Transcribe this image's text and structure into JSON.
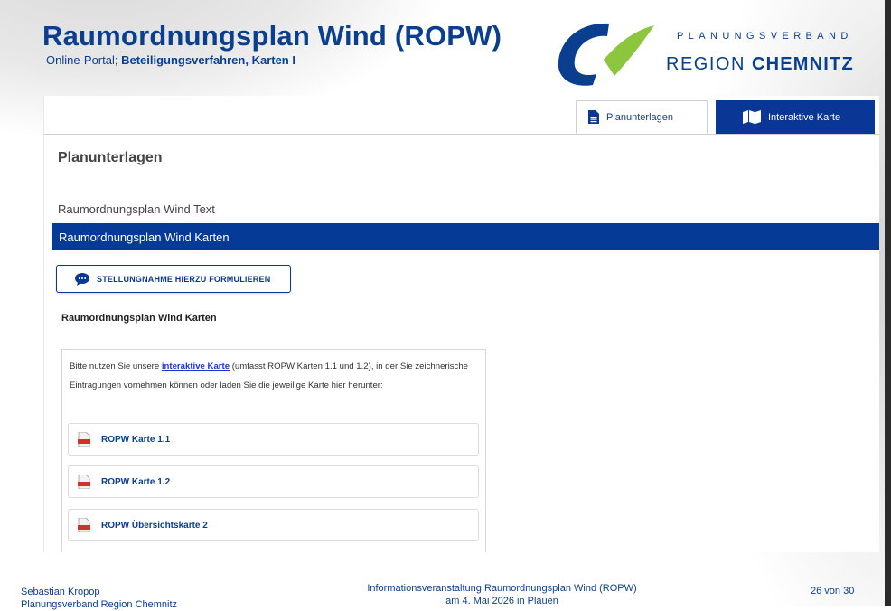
{
  "slide": {
    "title": "Raumordnungsplan Wind (ROPW)",
    "subtitle_prefix": "Online-Portal; ",
    "subtitle_bold": "Beteiligungsverfahren, Karten I"
  },
  "logo": {
    "line1": "PLANUNGSVERBAND",
    "line2_regular": "REGION ",
    "line2_bold": "CHEMNITZ",
    "colors": {
      "blue": "#0a3f8f",
      "green": "#8cc63f"
    }
  },
  "tabs": [
    {
      "label": "Planunterlagen",
      "icon": "document-icon",
      "active": true
    },
    {
      "label": "Interaktive Karte",
      "icon": "map-icon",
      "active": false
    }
  ],
  "page": {
    "section_title": "Planunterlagen",
    "nav_items": [
      "Raumordnungsplan Wind Text",
      "Raumordnungsplan Wind Karten"
    ],
    "statement_button": "STELLUNGNAHME HIERZU FORMULIEREN",
    "content_heading": "Raumordnungsplan Wind Karten",
    "info": {
      "before": "Bitte nutzen Sie unsere ",
      "link": "interaktive Karte",
      "after": " (umfasst ROPW Karten 1.1 und 1.2), in der Sie zeichnerische Eintragungen vornehmen können oder laden Sie die jeweilige Karte hier herunter:"
    },
    "files": [
      "ROPW Karte 1.1",
      "ROPW Karte 1.2",
      "ROPW Übersichtskarte 2"
    ]
  },
  "footer": {
    "author": "Sebastian Kropop",
    "organisation": "Planungsverband Region Chemnitz",
    "event_line1": "Informationsveranstaltung Raumordnungsplan Wind (ROPW)",
    "event_line2": "am 4. Mai 2026 in Plauen",
    "page": "26 von 30"
  },
  "colors": {
    "primary": "#0a3796",
    "title": "#0a3f8f",
    "link": "#1a33d6",
    "pdf": "#d0312d"
  }
}
